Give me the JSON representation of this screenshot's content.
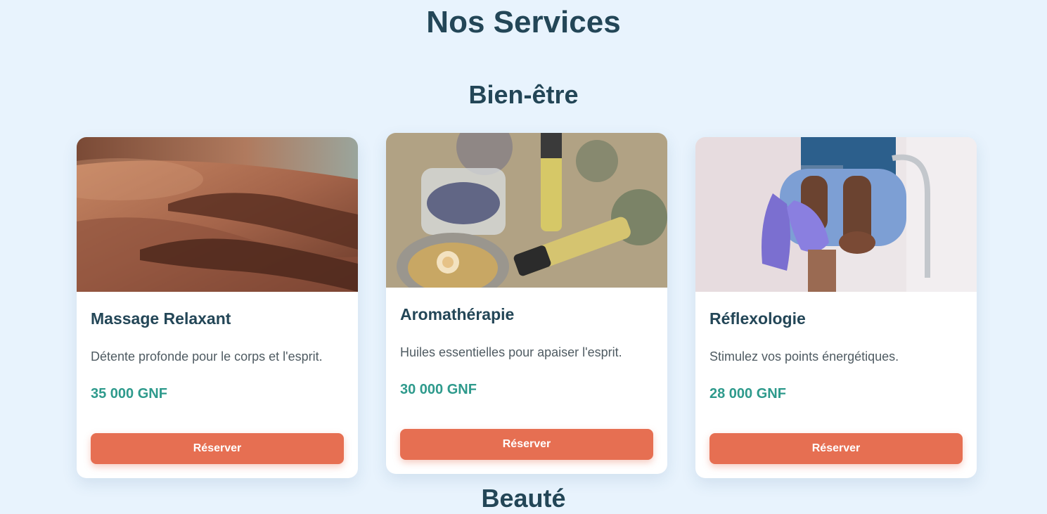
{
  "page_title": "Nos Services",
  "sections": [
    {
      "title": "Bien-être",
      "services": [
        {
          "image": "massage-photo",
          "title": "Massage Relaxant",
          "description": "Détente profonde pour le corps et l'esprit.",
          "price": "35 000 GNF",
          "button_label": "Réserver"
        },
        {
          "image": "aromatherapy-photo",
          "title": "Aromathérapie",
          "description": "Huiles essentielles pour apaiser l'esprit.",
          "price": "30 000 GNF",
          "button_label": "Réserver"
        },
        {
          "image": "reflexology-photo",
          "title": "Réflexologie",
          "description": "Stimulez vos points énergétiques.",
          "price": "28 000 GNF",
          "button_label": "Réserver"
        }
      ]
    },
    {
      "title": "Beauté",
      "services": []
    }
  ],
  "colors": {
    "background": "#e8f3fd",
    "heading": "#234657",
    "price": "#2e9a8c",
    "button": "#e66f52",
    "card": "#ffffff"
  }
}
